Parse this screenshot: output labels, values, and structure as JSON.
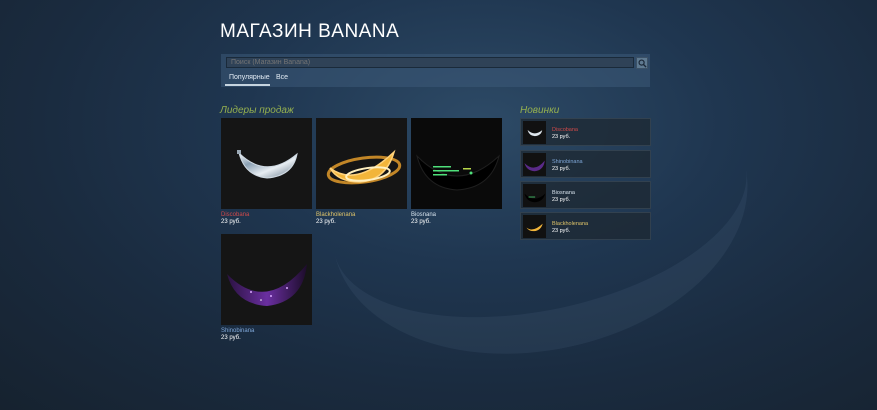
{
  "store": {
    "title": "МАГАЗИН BANANA",
    "search_placeholder": "Поиск (Магазин Banana)",
    "tabs": [
      {
        "label": "Популярные",
        "active": true
      },
      {
        "label": "Все",
        "active": false
      }
    ]
  },
  "bestsellers": {
    "title": "Лидеры продаж",
    "items": [
      {
        "name": "Discobana",
        "price": "23 руб.",
        "color": "#d24a4a"
      },
      {
        "name": "Blackholenana",
        "price": "23 руб.",
        "color": "#e0c56a"
      },
      {
        "name": "Biosnana",
        "price": "23 руб.",
        "color": "#d8e4ee"
      },
      {
        "name": "Shinobinana",
        "price": "23 руб.",
        "color": "#7fa7d8"
      }
    ]
  },
  "new_items": {
    "title": "Новинки",
    "items": [
      {
        "name": "Discobana",
        "price": "23 руб."
      },
      {
        "name": "Shinobinana",
        "price": "23 руб."
      },
      {
        "name": "Biosnana",
        "price": "23 руб."
      },
      {
        "name": "Blackholenana",
        "price": "23 руб."
      }
    ]
  },
  "icons": {
    "search": "search-icon",
    "banana": "banana-icon"
  }
}
